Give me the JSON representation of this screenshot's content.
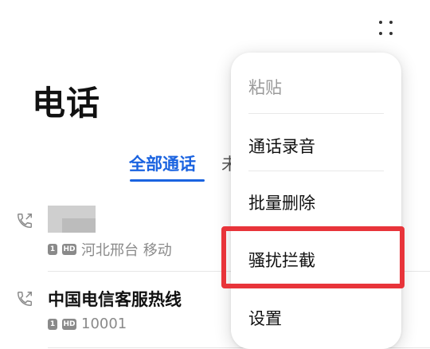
{
  "header": {
    "title": "电话",
    "more_icon": "more-vertical-dots-icon"
  },
  "tabs": {
    "active_label": "全部通话",
    "partial_label": "未接来电"
  },
  "calls": [
    {
      "name": "",
      "number_redacted": true,
      "sim_badge": "1",
      "hd_badge": "HD",
      "location": "河北邢台 移动",
      "icon": "outgoing-call-icon"
    },
    {
      "name": "中国电信客服热线",
      "number_redacted": false,
      "sim_badge": "1",
      "hd_badge": "HD",
      "location": "10001",
      "icon": "outgoing-call-icon"
    }
  ],
  "menu": {
    "items": [
      {
        "label": "粘贴",
        "enabled": false
      },
      {
        "label": "通话录音",
        "enabled": true
      },
      {
        "label": "批量删除",
        "enabled": true
      },
      {
        "label": "骚扰拦截",
        "enabled": true,
        "highlighted": true
      },
      {
        "label": "设置",
        "enabled": true
      }
    ]
  },
  "colors": {
    "accent": "#1a63e0",
    "highlight": "#e8343a",
    "meta_text": "#8a8a8a"
  }
}
